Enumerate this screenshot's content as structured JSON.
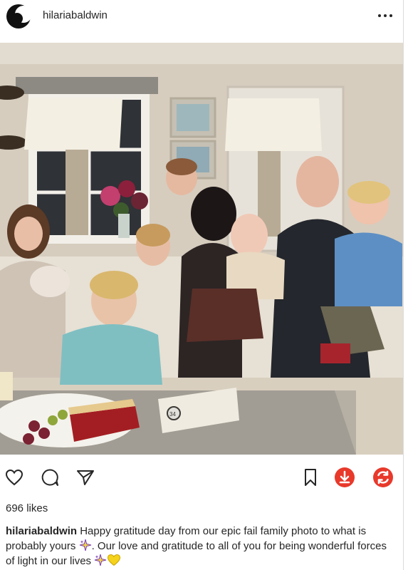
{
  "post": {
    "username": "hilariabaldwin",
    "likes": "696 likes",
    "caption": {
      "username": "hilariabaldwin",
      "part1": "Happy gratitude day from our epic fail family photo to what is probably yours",
      "part2": ". Our love and gratitude to all of you for being wonderful forces of light in our lives"
    },
    "photo_box_label": "34"
  },
  "icons": {
    "more": "more-options-icon",
    "like": "heart-icon",
    "comment": "comment-icon",
    "share": "send-icon",
    "save": "bookmark-icon",
    "download": "download-icon",
    "refresh": "refresh-icon",
    "emoji1": "sparkles-emoji",
    "emoji2": "sparkles-emoji",
    "emoji3": "yellow-heart-emoji"
  },
  "colors": {
    "text": "#262626",
    "download_red": "#e8392b",
    "refresh_red": "#e8392b",
    "heart_yellow": "#f5d21b",
    "sparkle_purple": "#7b3fb5"
  }
}
